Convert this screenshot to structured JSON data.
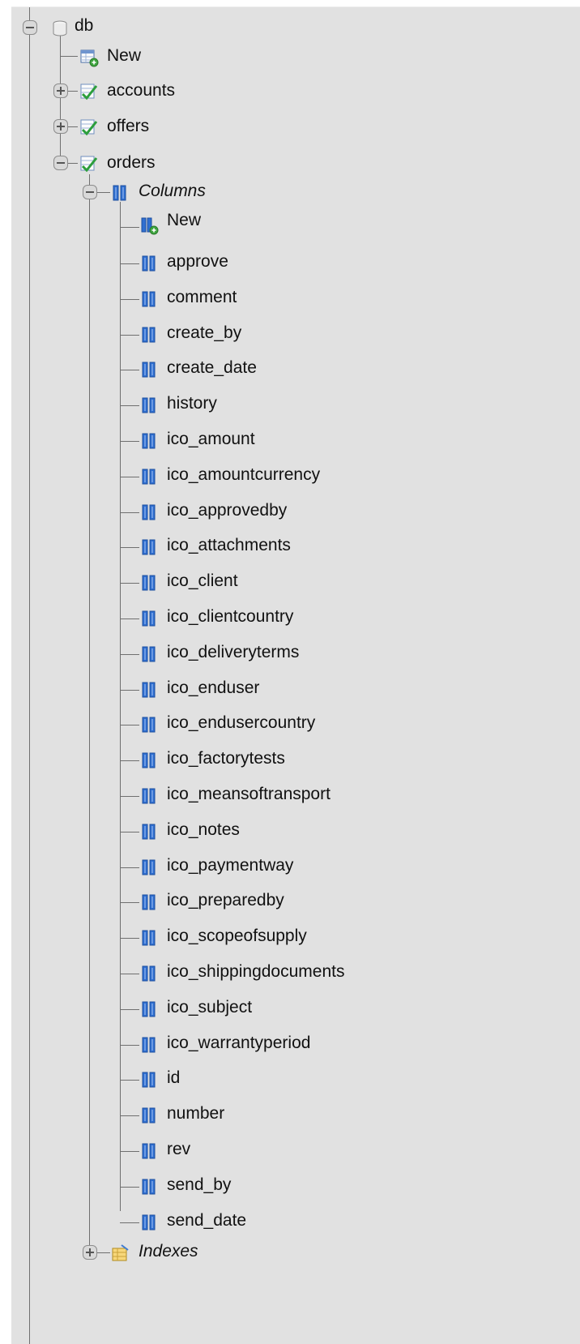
{
  "tree": {
    "db": {
      "label": "db"
    },
    "db_new": {
      "label": "New"
    },
    "tables": [
      {
        "label": "accounts"
      },
      {
        "label": "offers"
      },
      {
        "label": "orders"
      }
    ],
    "columns_group": {
      "label": "Columns"
    },
    "columns_new": {
      "label": "New"
    },
    "columns": [
      "approve",
      "comment",
      "create_by",
      "create_date",
      "history",
      "ico_amount",
      "ico_amountcurrency",
      "ico_approvedby",
      "ico_attachments",
      "ico_client",
      "ico_clientcountry",
      "ico_deliveryterms",
      "ico_enduser",
      "ico_endusercountry",
      "ico_factorytests",
      "ico_meansoftransport",
      "ico_notes",
      "ico_paymentway",
      "ico_preparedby",
      "ico_scopeofsupply",
      "ico_shippingdocuments",
      "ico_subject",
      "ico_warrantyperiod",
      "id",
      "number",
      "rev",
      "send_by",
      "send_date"
    ],
    "indexes_group": {
      "label": "Indexes"
    }
  },
  "icons": {
    "database": "database-icon",
    "new_table": "new-table-icon",
    "table": "table-icon",
    "column": "column-icon",
    "new_column": "new-column-icon",
    "index": "index-icon"
  },
  "colors": {
    "panel_bg": "#e1e1e1",
    "tree_line": "#6f6f6f",
    "column_blue": "#2f6fd1",
    "table_green": "#2c9e3c"
  }
}
